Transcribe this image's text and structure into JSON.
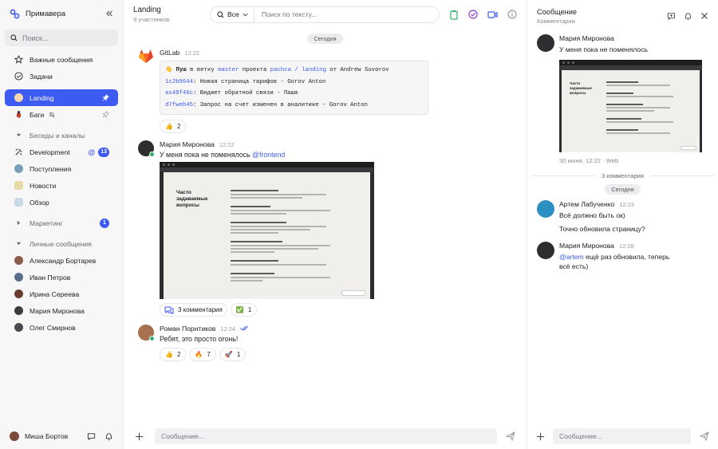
{
  "sidebar": {
    "workspace": "Примавера",
    "search_placeholder": "Поиск...",
    "top_items": [
      {
        "label": "Важные сообщения"
      },
      {
        "label": "Задачи"
      }
    ],
    "pinned": [
      {
        "label": "Landing"
      },
      {
        "label": "Баги"
      }
    ],
    "sections": {
      "channels": "Беседы и каналы",
      "direct": "Личные сообщения"
    },
    "channels": [
      {
        "label": "Development",
        "count": "13"
      },
      {
        "label": "Поступления"
      },
      {
        "label": "Новости"
      },
      {
        "label": "Обзор"
      }
    ],
    "marketing": {
      "label": "Маркетинг",
      "count": "1"
    },
    "people": [
      {
        "label": "Александр Бортарев"
      },
      {
        "label": "Иван Петров"
      },
      {
        "label": "Ирина Сереева"
      },
      {
        "label": "Мария Миронова"
      },
      {
        "label": "Олег Смирнов"
      }
    ],
    "user": "Миша Бортов"
  },
  "main": {
    "title": "Landing",
    "subtitle": "9 участников",
    "filter": "Все",
    "search_placeholder": "Поиск по тексту...",
    "date": "Сегодня",
    "messages": [
      {
        "author": "GitLab",
        "time": "12:22",
        "push": {
          "emoji": "👋",
          "p1": "Пуш",
          "p2": "в ветку",
          "branch": "master",
          "p3": "проекта",
          "project": "pachca / landing",
          "p4": "от Andrew Suvorov"
        },
        "commits": [
          {
            "hash": "1c2b9644",
            "msg": ": Новая страница тарифов - Gorov Anton"
          },
          {
            "hash": "as48f46c",
            "msg": ": Виджет обратной связи - Паша"
          },
          {
            "hash": "d7fweb45",
            "msg": ": Запрос на счет изменен в аналитике - Gorov Anton"
          }
        ],
        "reaction": {
          "emoji": "👍",
          "count": "2"
        }
      },
      {
        "author": "Мария Миронова",
        "time": "12:22",
        "text": "У меня пока не поменялось ",
        "mention": "@frontend",
        "shot_title": "Часто задаваемые вопросы",
        "comments": "3 комментария",
        "check": {
          "emoji": "✅",
          "count": "1"
        }
      },
      {
        "author": "Роман Порнтиков",
        "time": "12:24",
        "text": "Ребят, это просто огонь!",
        "reactions": [
          {
            "emoji": "👍",
            "count": "2"
          },
          {
            "emoji": "🔥",
            "count": "7"
          },
          {
            "emoji": "🚀",
            "count": "1"
          }
        ]
      }
    ],
    "composer_placeholder": "Сообщение..."
  },
  "thread": {
    "title": "Сообщение",
    "subtitle": "Комментарии",
    "root": {
      "author": "Мария Миронова",
      "text": "У меня пока не поменялось",
      "meta": "30 июня, 12:22 · Web"
    },
    "count": "3 комментария",
    "date": "Сегодня",
    "replies": [
      {
        "author": "Артем Лабученко",
        "time": "12:23",
        "text1": "Всё должно быть ок)",
        "text2": "Точно обновила страницу?"
      },
      {
        "author": "Мария Миронова",
        "time": "12:28",
        "mention": "@artem",
        "text": " ещё раз обновила, теперь всё есть)"
      }
    ],
    "composer_placeholder": "Сообщение..."
  },
  "colors": {
    "accent": "#3d5af1",
    "check": "#2fb36b",
    "clip": "#2fb36b",
    "purple": "#8f3dd8"
  }
}
